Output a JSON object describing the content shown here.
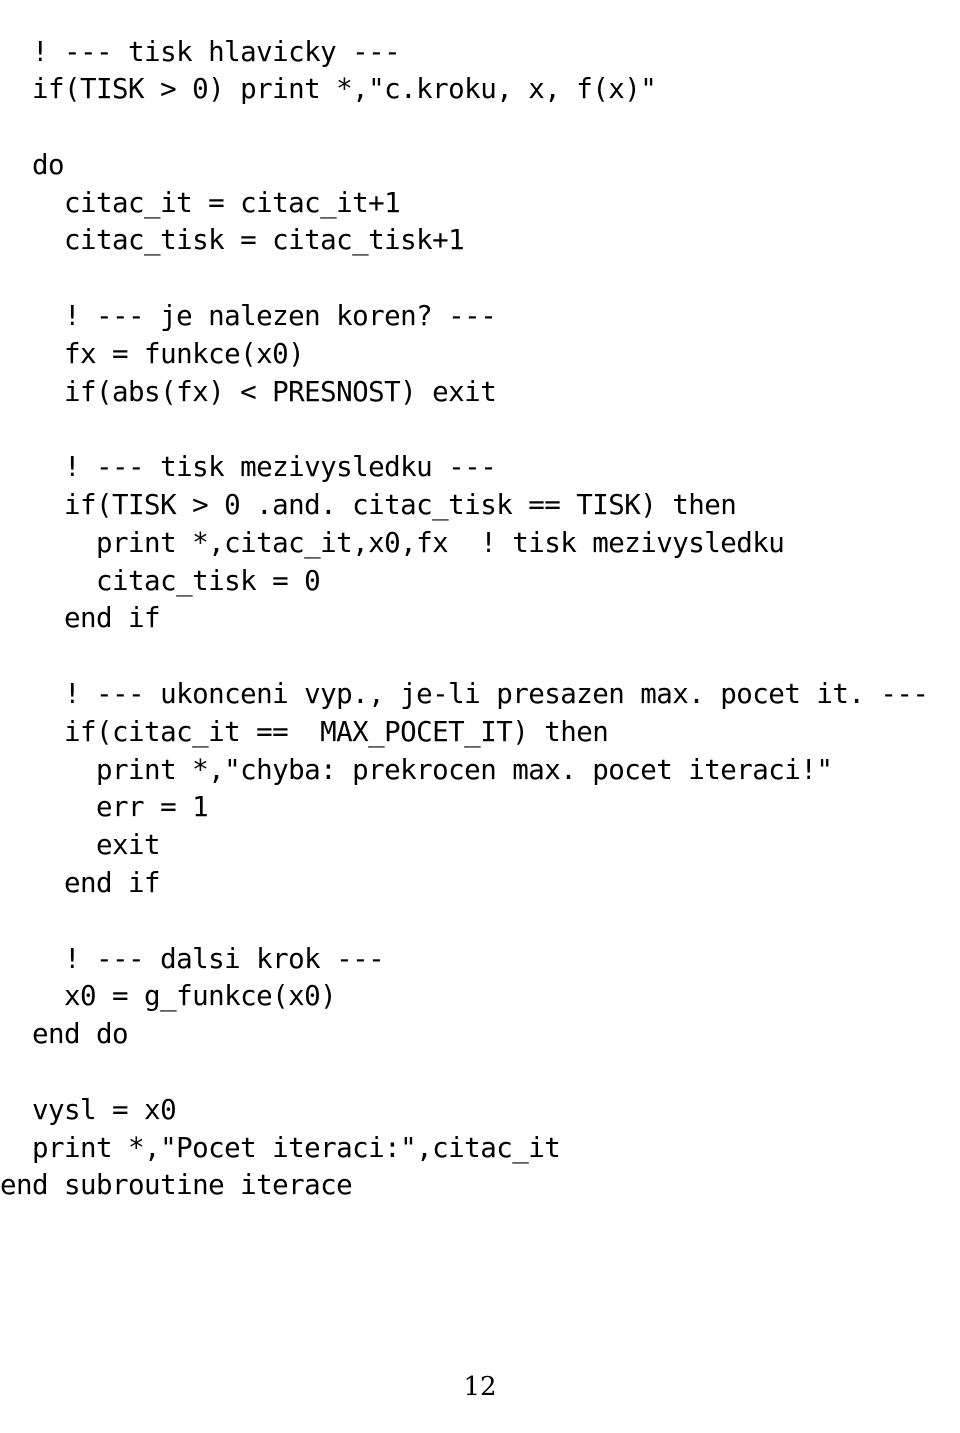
{
  "document": {
    "kind": "code-listing",
    "language": "Fortran",
    "page_number": "12",
    "indent_unit_spaces": 2,
    "base_indent_spaces": 4,
    "lines": [
      "  ! --- tisk hlavicky ---",
      "  if(TISK > 0) print *,\"c.kroku, x, f(x)\"",
      "",
      "  do",
      "    citac_it = citac_it+1",
      "    citac_tisk = citac_tisk+1",
      "",
      "    ! --- je nalezen koren? ---",
      "    fx = funkce(x0)",
      "    if(abs(fx) < PRESNOST) exit",
      "",
      "    ! --- tisk mezivysledku ---",
      "    if(TISK > 0 .and. citac_tisk == TISK) then",
      "      print *,citac_it,x0,fx  ! tisk mezivysledku",
      "      citac_tisk = 0",
      "    end if",
      "",
      "    ! --- ukonceni vyp., je-li presazen max. pocet it. ---",
      "    if(citac_it ==  MAX_POCET_IT) then",
      "      print *,\"chyba: prekrocen max. pocet iteraci!\"",
      "      err = 1",
      "      exit",
      "    end if",
      "",
      "    ! --- dalsi krok ---",
      "    x0 = g_funkce(x0)",
      "  end do",
      "",
      "  vysl = x0",
      "  print *,\"Pocet iteraci:\",citac_it",
      "end subroutine iterace"
    ]
  }
}
